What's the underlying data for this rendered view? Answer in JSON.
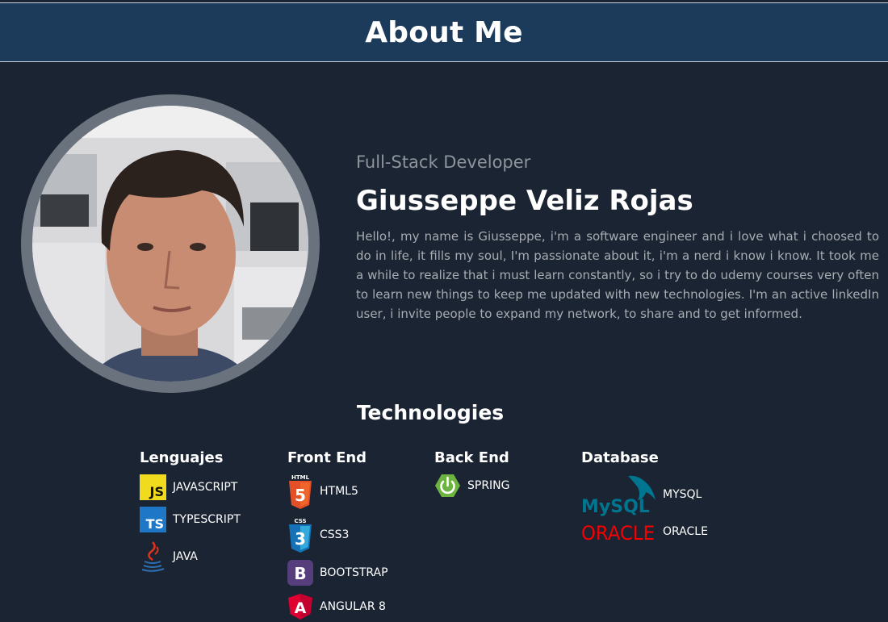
{
  "header": {
    "title": "About Me"
  },
  "profile": {
    "subtitle": "Full-Stack Developer",
    "name": "Giusseppe Veliz Rojas",
    "bio": "Hello!, my name is Giusseppe, i'm a software engineer and i love what i choosed to do in life, it fills my soul, I'm passionate about it, i'm a nerd i know i know. It took me a while to realize that i must learn constantly, so i try to do udemy courses very often to learn new things to keep me updated with new technologies. I'm an active linkedIn user, i invite people to expand my network, to share and to get informed."
  },
  "technologies": {
    "title": "Technologies",
    "columns": [
      {
        "title": "Lenguajes",
        "items": [
          {
            "label": "JAVASCRIPT",
            "icon": "javascript-icon"
          },
          {
            "label": "TYPESCRIPT",
            "icon": "typescript-icon"
          },
          {
            "label": "JAVA",
            "icon": "java-icon"
          }
        ]
      },
      {
        "title": "Front End",
        "items": [
          {
            "label": "HTML5",
            "icon": "html5-icon"
          },
          {
            "label": "CSS3",
            "icon": "css3-icon"
          },
          {
            "label": "BOOTSTRAP",
            "icon": "bootstrap-icon"
          },
          {
            "label": "ANGULAR 8",
            "icon": "angular-icon"
          }
        ]
      },
      {
        "title": "Back End",
        "items": [
          {
            "label": "SPRING",
            "icon": "spring-icon"
          }
        ]
      },
      {
        "title": "Database",
        "items": [
          {
            "label": "MYSQL",
            "icon": "mysql-logo"
          },
          {
            "label": "ORACLE",
            "icon": "oracle-logo"
          }
        ]
      }
    ]
  },
  "logos": {
    "mysql": "MySQL",
    "oracle": "ORACLE",
    "html": "HTML",
    "css": "CSS",
    "js": "JS",
    "ts": "TS",
    "bootstrap": "B",
    "angular": "A"
  },
  "colors": {
    "header_bg": "#1c3b5a",
    "page_bg": "#1b2432",
    "ring": "#6a737d",
    "muted_text": "#a7acb2"
  }
}
